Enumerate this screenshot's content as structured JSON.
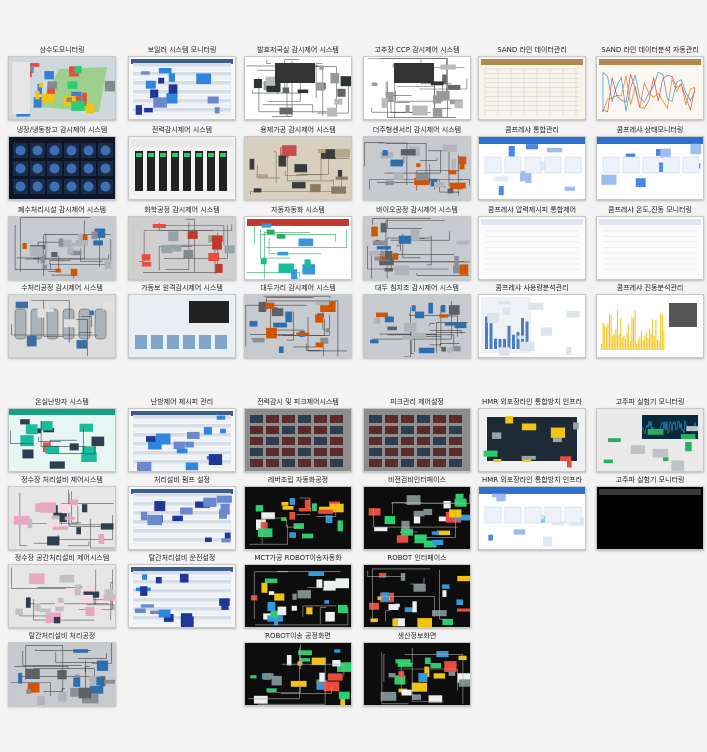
{
  "groups": [
    {
      "tiles": [
        {
          "label": "상수도모니터링",
          "theme": "map"
        },
        {
          "label": "보일러 시스템 모니터링",
          "theme": "table"
        },
        {
          "label": "발효저국실 감시제어 시스템",
          "theme": "white-mimic"
        },
        {
          "label": "고추장 CCP 감시제어 시스템",
          "theme": "white-mimic"
        },
        {
          "label": "SAND 라인 데이터관리",
          "theme": "grid"
        },
        {
          "label": "SAND 라인 데이터분석 자동관리",
          "theme": "chart"
        },
        {
          "label": "냉장/냉동창고 감시제어 시스템",
          "theme": "gauges"
        },
        {
          "label": "전력감시제어 시스템",
          "theme": "bars"
        },
        {
          "label": "용제가공 감시제어 시스템",
          "theme": "beige"
        },
        {
          "label": "더주형센서리 감시제어 시스템",
          "theme": "gray-mimic"
        },
        {
          "label": "콤프레샤 통합관리",
          "theme": "web"
        },
        {
          "label": "콤프레샤 상태모니터링",
          "theme": "web"
        },
        {
          "label": "폐수처리시설 감시제어 시스템",
          "theme": "gray-mimic"
        },
        {
          "label": "화학공정 감시제어 시스템",
          "theme": "red-mimic"
        },
        {
          "label": "자동자동화 시스템",
          "theme": "green-mimic"
        },
        {
          "label": "바이오공정 감시제어 시스템",
          "theme": "gray-mimic"
        },
        {
          "label": "콤프레샤 압력제시피 통합제어",
          "theme": "plain"
        },
        {
          "label": "콤프레샤 온도,진동 모니터링",
          "theme": "plain"
        },
        {
          "label": "수처리공정 감시제어 시스템",
          "theme": "tanks"
        },
        {
          "label": "가동보 원격감시제어 시스템",
          "theme": "hmi-blue"
        },
        {
          "label": "대두가리 감시제어 시스템",
          "theme": "gray-mimic"
        },
        {
          "label": "대두 침지조 감시제어 시스템",
          "theme": "gray-mimic"
        },
        {
          "label": "콤프레샤 사용량분석관리",
          "theme": "barchart"
        },
        {
          "label": "콤프레샤 진동분석관리",
          "theme": "yellowchart"
        }
      ]
    },
    {
      "tiles": [
        {
          "label": "온실난방자 시스템",
          "theme": "teal"
        },
        {
          "label": "난방제어 제시피 관리",
          "theme": "table"
        },
        {
          "label": "전력감시 및 피크제어시스템",
          "theme": "darkgray"
        },
        {
          "label": "피크관리 제어설정",
          "theme": "darkgray"
        },
        {
          "label": "HMR 외포장라인 통합방치 인프라",
          "theme": "dark-monitor"
        },
        {
          "label": "고주파 실험기 모니터링",
          "theme": "wave"
        },
        {
          "label": "정수장 처리설비 제어시스템",
          "theme": "pink"
        },
        {
          "label": "처리설비 펌프 설정",
          "theme": "table"
        },
        {
          "label": "레버조립 자동화공정",
          "theme": "black-hmi"
        },
        {
          "label": "비전검비인터페이스",
          "theme": "black-hmi"
        },
        {
          "label": "HMR 외포장라인 통합방치 인프라",
          "theme": "web"
        },
        {
          "label": "고주파 실험기 모니터링",
          "theme": "black"
        },
        {
          "label": "정수장 공간처리설비 제어시스템",
          "theme": "pink"
        },
        {
          "label": "탈간처리설비 운전설정",
          "theme": "table"
        },
        {
          "label": "MCT가공 ROBOT이송자동화",
          "theme": "black-hmi"
        },
        {
          "label": "ROBOT 인터페이스",
          "theme": "black-hmi"
        },
        {
          "label": "탈간처리설비 처리공정",
          "theme": "gray-mimic"
        },
        {
          "label": "ROBOT이송 공정화면",
          "theme": "black-hmi"
        },
        {
          "label": "생산정보화면",
          "theme": "black-hmi"
        }
      ]
    }
  ]
}
